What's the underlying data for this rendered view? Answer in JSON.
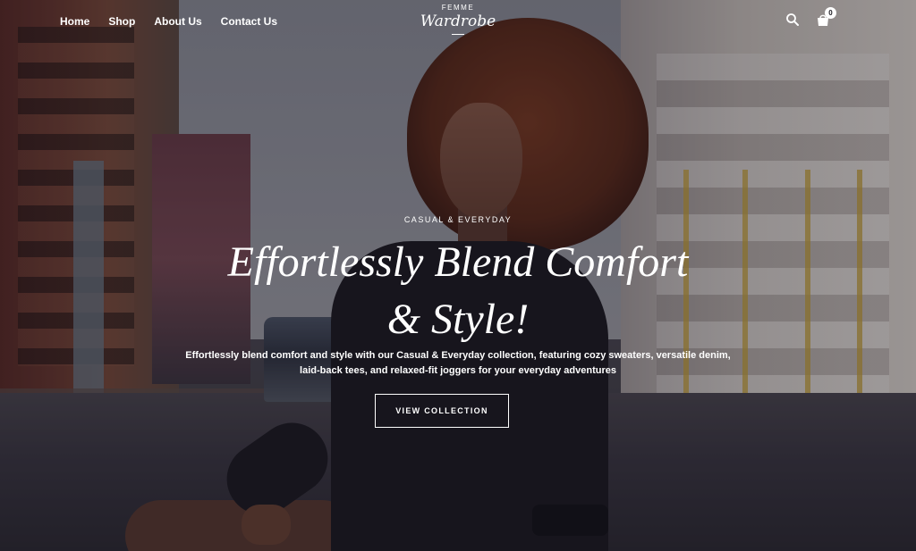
{
  "header": {
    "nav": [
      "Home",
      "Shop",
      "About Us",
      "Contact Us"
    ],
    "logo_top": "FEMME",
    "logo_main": "Wardrobe",
    "cart_count": "0",
    "icons": [
      "search-icon",
      "shopping-bag-icon"
    ]
  },
  "hero": {
    "eyebrow": "CASUAL & EVERYDAY",
    "headline_line1": "Effortlessly Blend Comfort",
    "headline_line2": "& Style!",
    "description": "Effortlessly blend comfort and style with our Casual & Everyday collection, featuring cozy sweaters, versatile denim, laid-back tees, and relaxed-fit joggers for your everyday adventures",
    "cta_label": "VIEW COLLECTION"
  },
  "colors": {
    "text": "#ffffff",
    "overlay": "#120e16",
    "dark": "#1b1a21"
  }
}
